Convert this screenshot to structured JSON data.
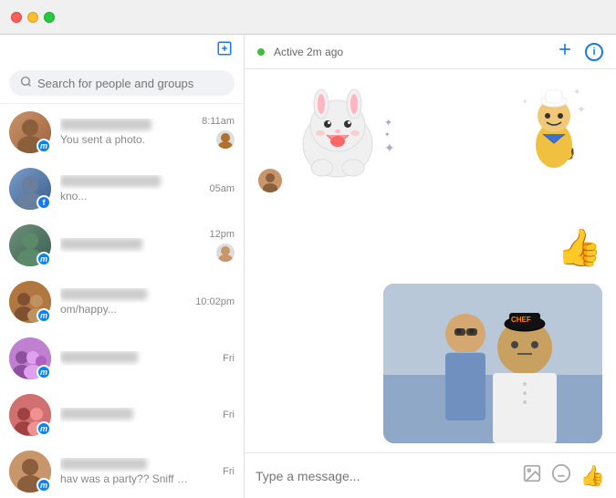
{
  "titlebar": {
    "active_status": "Active 2m ago",
    "compose_label": "Compose",
    "add_label": "Add",
    "info_label": "Info"
  },
  "sidebar": {
    "search_placeholder": "Search for people and groups",
    "conversations": [
      {
        "id": 1,
        "name": "Nidia Figueroa",
        "preview": "You sent a photo.",
        "time": "8:11am",
        "avatar_color": "female-1",
        "badge": "messenger",
        "has_thumb": true
      },
      {
        "id": 2,
        "name": "Noman Ahmad Mir",
        "preview": "kno...",
        "time": "05am",
        "avatar_color": "male-1",
        "badge": "fb",
        "has_thumb": false
      },
      {
        "id": 3,
        "name": "Hafeez Sahib",
        "preview": "",
        "time": "12pm",
        "avatar_color": "male-2",
        "badge": "messenger",
        "has_thumb": true
      },
      {
        "id": 4,
        "name": "Saran Ujjwal",
        "preview": "om/happy...",
        "time": "10:02pm",
        "avatar_color": "group-1",
        "badge": "messenger",
        "has_thumb": false
      },
      {
        "id": 5,
        "name": "Furqan Mag",
        "preview": "",
        "time": "Fri",
        "avatar_color": "group-2",
        "badge": "messenger",
        "has_thumb": false
      },
      {
        "id": 6,
        "name": "Dadi Bhai",
        "preview": "",
        "time": "Fri",
        "avatar_color": "group-3",
        "badge": "messenger",
        "has_thumb": false
      },
      {
        "id": 7,
        "name": "Nadia Bianca",
        "preview": "hav was a party?? Sniff s...",
        "time": "Fri",
        "avatar_color": "female-1",
        "badge": "messenger",
        "has_thumb": false
      }
    ]
  },
  "chat": {
    "input_placeholder": "Type a message...",
    "messages": [
      {
        "type": "sticker_bunny",
        "side": "incoming"
      },
      {
        "type": "thumbsup",
        "side": "outgoing"
      },
      {
        "type": "photo",
        "side": "outgoing"
      }
    ]
  }
}
